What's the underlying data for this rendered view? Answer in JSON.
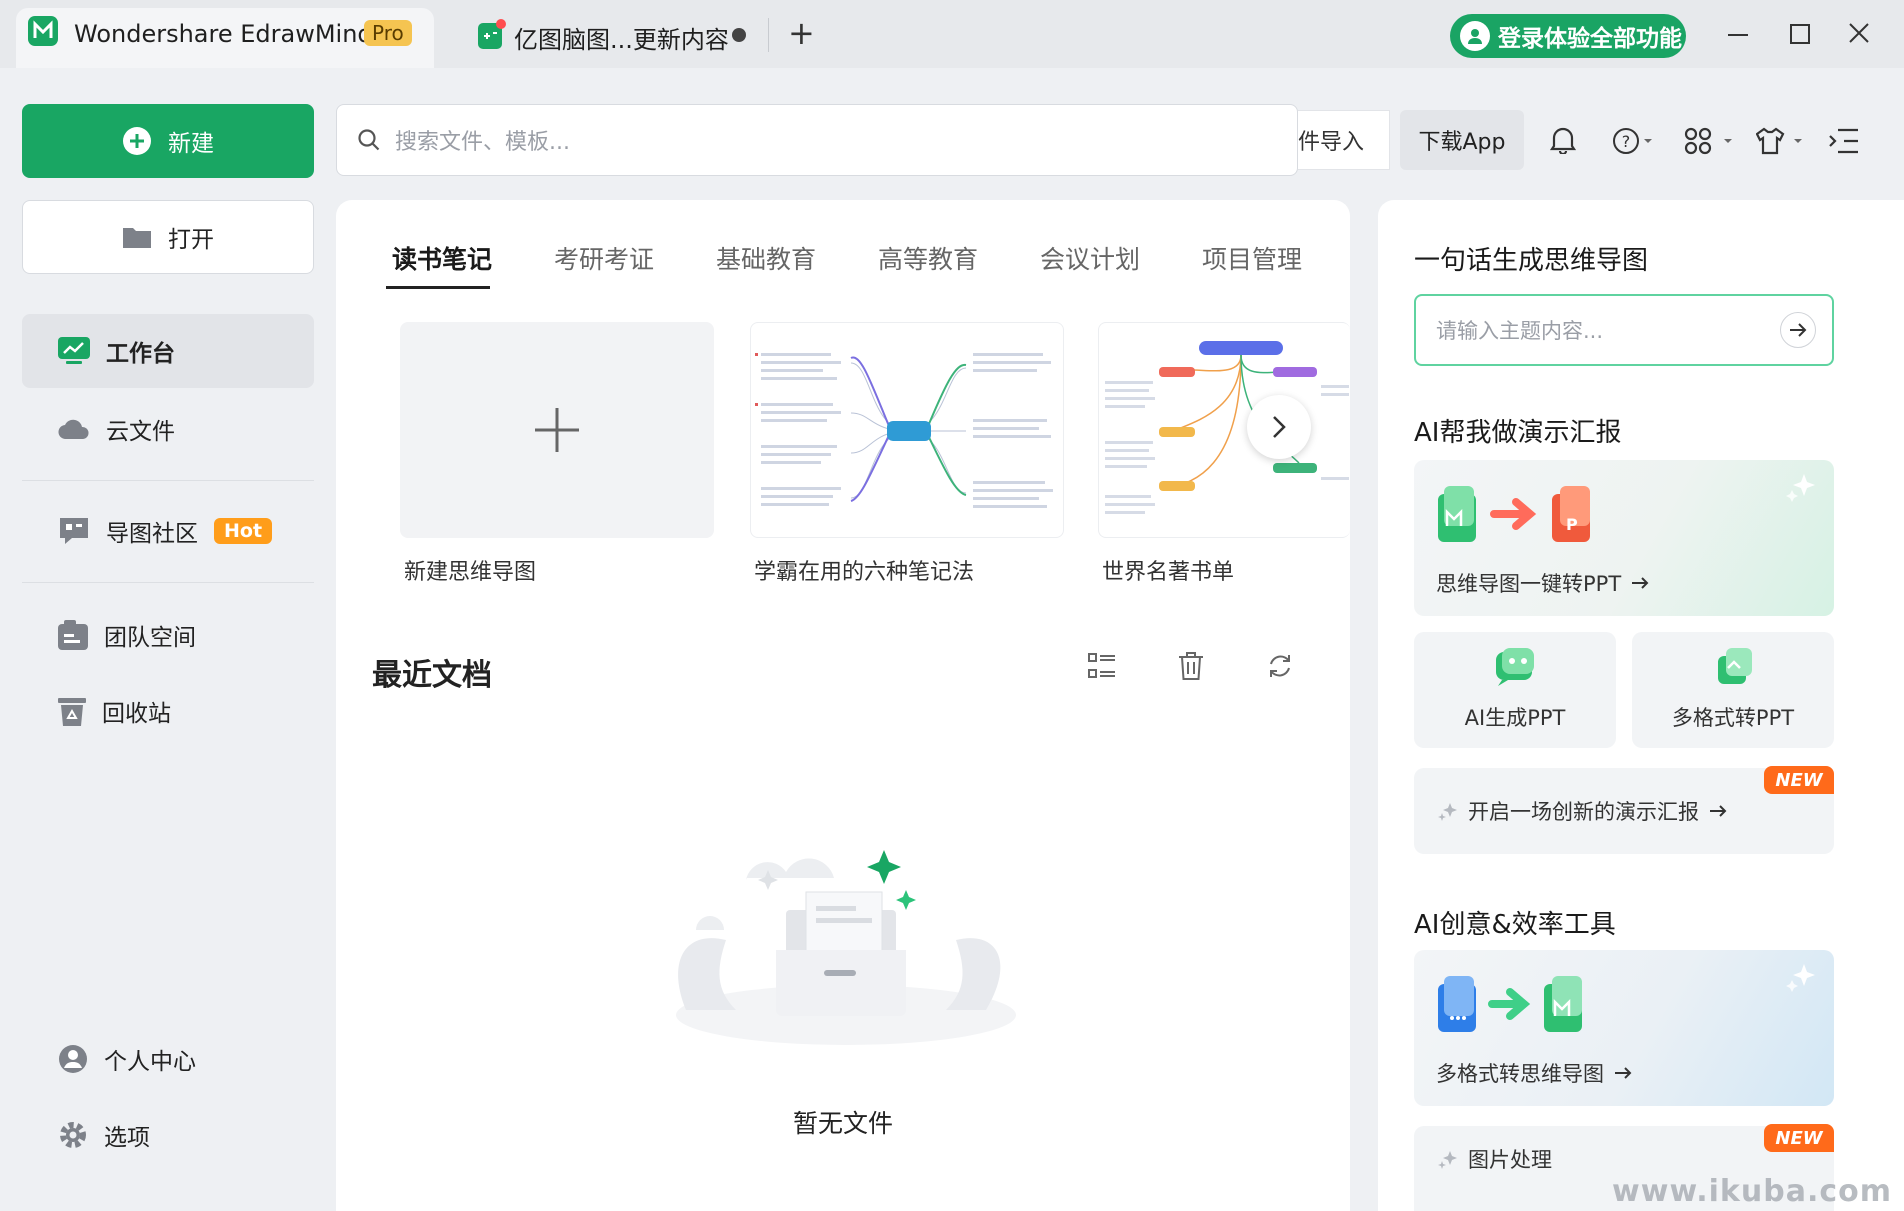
{
  "titlebar": {
    "app_tab_title": "Wondershare EdrawMind",
    "pro_badge": "Pro",
    "doc_tab_title": "亿图脑图...更新内容",
    "login_button": "登录体验全部功能"
  },
  "sidebar": {
    "new_label": "新建",
    "open_label": "打开",
    "items": [
      {
        "label": "工作台"
      },
      {
        "label": "云文件"
      },
      {
        "label": "导图社区",
        "badge": "Hot"
      },
      {
        "label": "团队空间"
      },
      {
        "label": "回收站"
      },
      {
        "label": "个人中心"
      },
      {
        "label": "选项"
      }
    ]
  },
  "toolbar": {
    "search_placeholder": "搜索文件、模板...",
    "import_label": "件导入",
    "download_label": "下载App"
  },
  "templates": {
    "tabs": [
      "读书笔记",
      "考研考证",
      "基础教育",
      "高等教育",
      "会议计划",
      "项目管理"
    ],
    "active_tab": 0,
    "cards": [
      {
        "caption": "新建思维导图"
      },
      {
        "caption": "学霸在用的六种笔记法"
      },
      {
        "caption": "世界名著书单"
      }
    ]
  },
  "recent": {
    "title": "最近文档",
    "empty_text": "暂无文件"
  },
  "right_panel": {
    "generate_heading": "一句话生成思维导图",
    "topic_placeholder": "请输入主题内容...",
    "ai_present_heading": "AI帮我做演示汇报",
    "mindmap_to_ppt": "思维导图一键转PPT",
    "ai_generate_ppt": "AI生成PPT",
    "multi_format_ppt": "多格式转PPT",
    "start_presentation": "开启一场创新的演示汇报",
    "new_badge": "NEW",
    "ai_tools_heading": "AI创意&效率工具",
    "multi_format_mindmap": "多格式转思维导图",
    "image_processing": "图片处理"
  },
  "watermark": "www.ikuba.com",
  "colors": {
    "accent": "#19a663",
    "hot": "#ff9d1a",
    "new": "#ff6a1a"
  }
}
